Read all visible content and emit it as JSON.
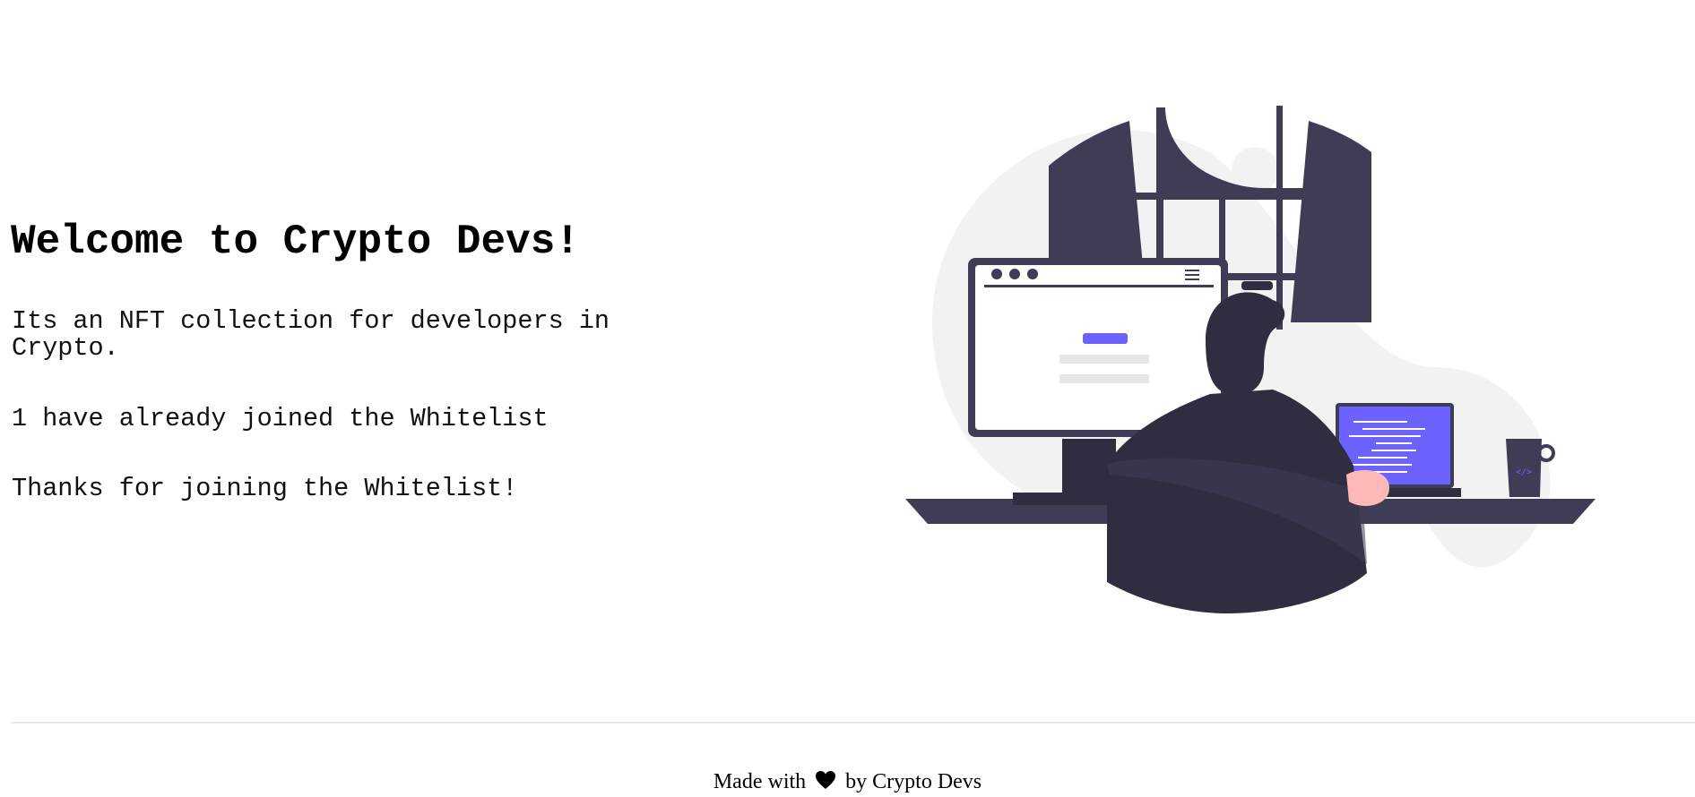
{
  "main": {
    "title": "Welcome to Crypto Devs!",
    "description": "Its an NFT collection for developers in Crypto.",
    "whitelist_status": "1 have already joined the Whitelist",
    "whitelist_message": "Thanks for joining the Whitelist!"
  },
  "illustration": {
    "icon": "developer-at-desk-illustration",
    "accent_color": "#6c63ff",
    "dark_color": "#3f3d56",
    "light_color": "#f2f2f2"
  },
  "footer": {
    "prefix": "Made with",
    "icon": "heart-icon",
    "suffix": "by Crypto Devs"
  }
}
